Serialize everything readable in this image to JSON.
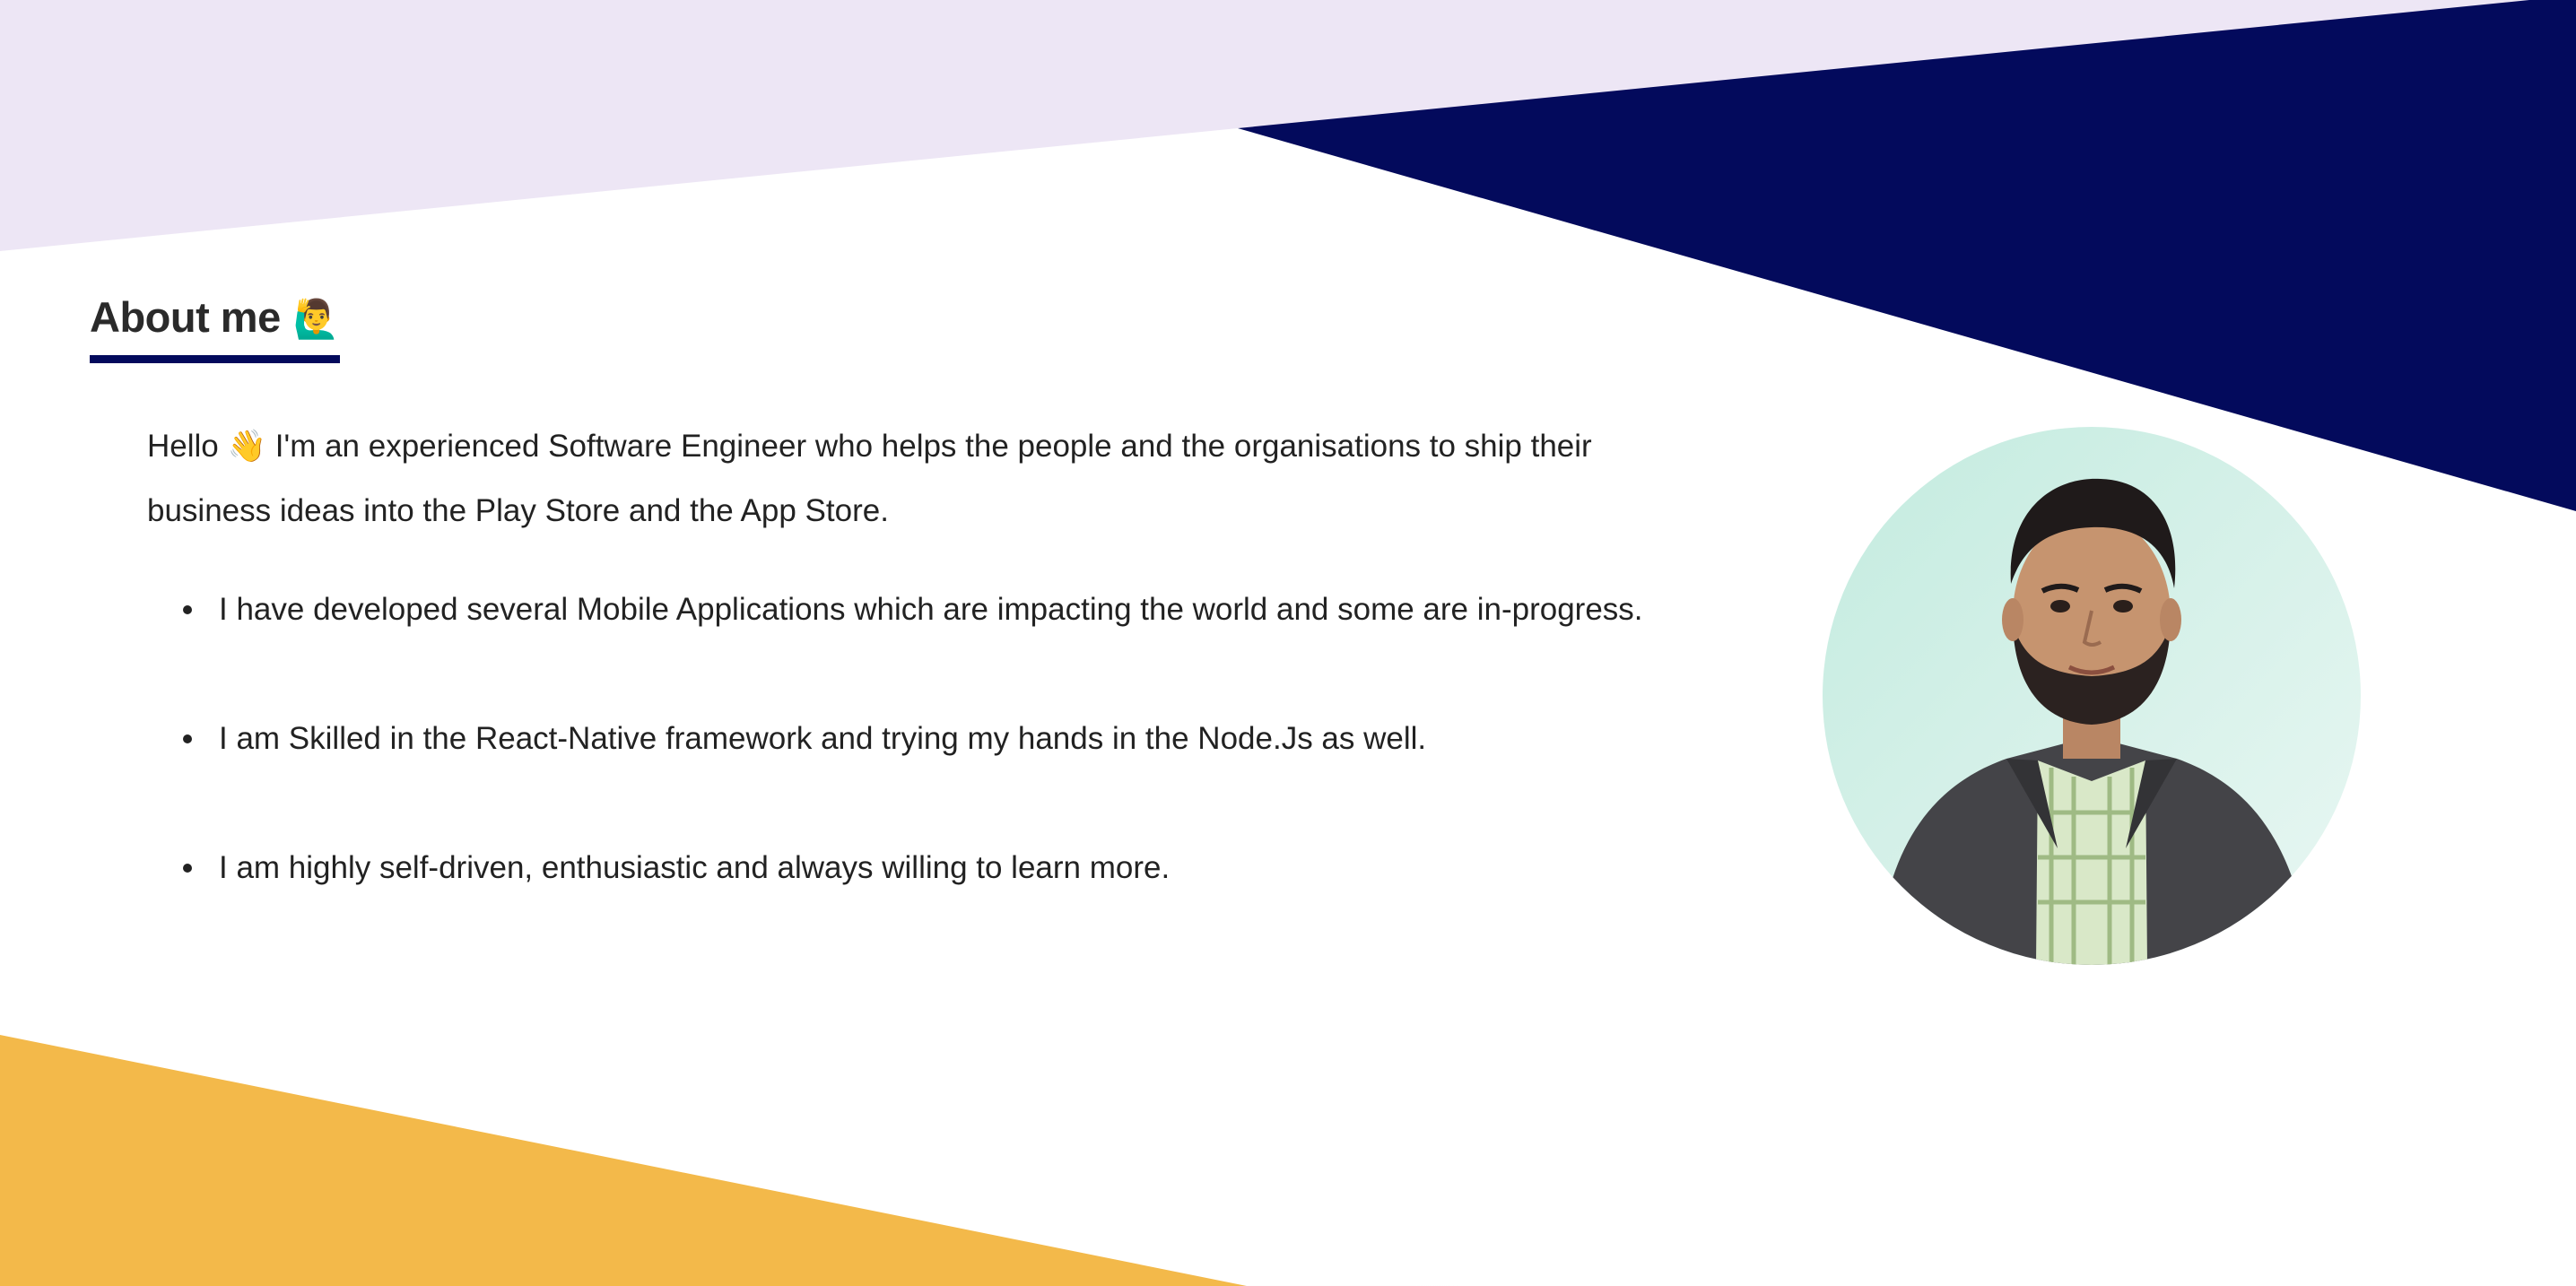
{
  "colors": {
    "lavender": "#ede6f5",
    "navy": "#030a5c",
    "mustard": "#f3b94a",
    "avatar_bg": "#cdeee4",
    "text": "#222222"
  },
  "about": {
    "heading": "About me",
    "heading_emoji": "🙋‍♂️",
    "intro_before_wave": "Hello ",
    "intro_wave_emoji": "👋",
    "intro_after_wave": " I'm an experienced Software Engineer who helps the people and the organisations to ship their business ideas into the Play Store and the App Store.",
    "points": [
      "I have developed several Mobile Applications which are impacting the world and some are in-progress.",
      "I am Skilled in the React-Native framework and trying my hands in the Node.Js as well.",
      "I am highly self-driven, enthusiastic and always willing to learn more."
    ]
  },
  "profile": {
    "icon": "profile-photo"
  }
}
